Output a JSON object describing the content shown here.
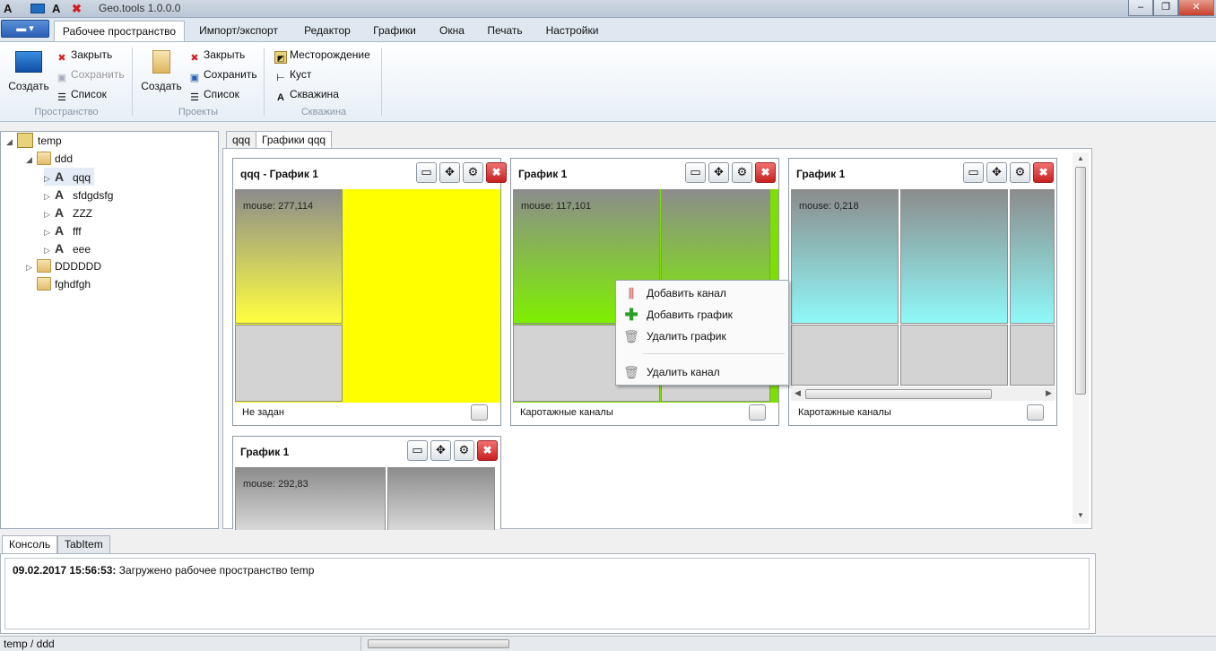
{
  "titlebar": {
    "title": "Geo.tools 1.0.0.0",
    "minimize": "–",
    "maximize": "❐",
    "close": "✕"
  },
  "ribbon_tabs": [
    {
      "label": "Рабочее пространство",
      "active": true
    },
    {
      "label": "Импорт/экспорт"
    },
    {
      "label": "Редактор"
    },
    {
      "label": "Графики"
    },
    {
      "label": "Окна"
    },
    {
      "label": "Печать"
    },
    {
      "label": "Настройки"
    }
  ],
  "ribbon": {
    "workspace": {
      "group_label": "Пространство",
      "create": "Создать",
      "close": "Закрыть",
      "save": "Сохранить",
      "list": "Список"
    },
    "projects": {
      "group_label": "Проекты",
      "create": "Создать",
      "close": "Закрыть",
      "save": "Сохранить",
      "list": "Список"
    },
    "well": {
      "group_label": "Скважина",
      "field": "Месторождение",
      "pad": "Куст",
      "well": "Скважина"
    }
  },
  "tree": {
    "root": "temp",
    "folder1": "ddd",
    "wells": [
      "qqq",
      "sfdgdsfg",
      "ZZZ",
      "fff",
      "eee"
    ],
    "folder2": "DDDDDD",
    "folder3": "fghdfgh"
  },
  "doc_tabs": [
    "qqq",
    "Графики qqq"
  ],
  "panels": [
    {
      "title": "qqq - График 1",
      "mouse": "mouse: 277,114",
      "footer": "Не задан"
    },
    {
      "title": "График 1",
      "mouse": "mouse: 117,101",
      "footer": "Каротажные каналы"
    },
    {
      "title": "График 1",
      "mouse": "mouse: 0,218",
      "footer": "Каротажные каналы"
    },
    {
      "title": "График 1",
      "mouse": "mouse: 292,83"
    }
  ],
  "panel_buttons": {
    "window": "▭",
    "move": "✥",
    "settings": "⚙",
    "close": "✖"
  },
  "context_menu": {
    "add_channel": "Добавить канал",
    "add_chart": "Добавить график",
    "delete_chart": "Удалить график",
    "delete_channel": "Удалить канал"
  },
  "console_tabs": [
    "Консоль",
    "TabItem"
  ],
  "console": {
    "timestamp": "09.02.2017 15:56:53:",
    "message": " Загружено рабочее пространство temp"
  },
  "status": {
    "path": "temp / ddd"
  },
  "colors": {
    "yellow": "#ffff00",
    "green": "#7ee000",
    "cyan": "#8ff8f8",
    "gray_track": "#d3d3d3"
  }
}
